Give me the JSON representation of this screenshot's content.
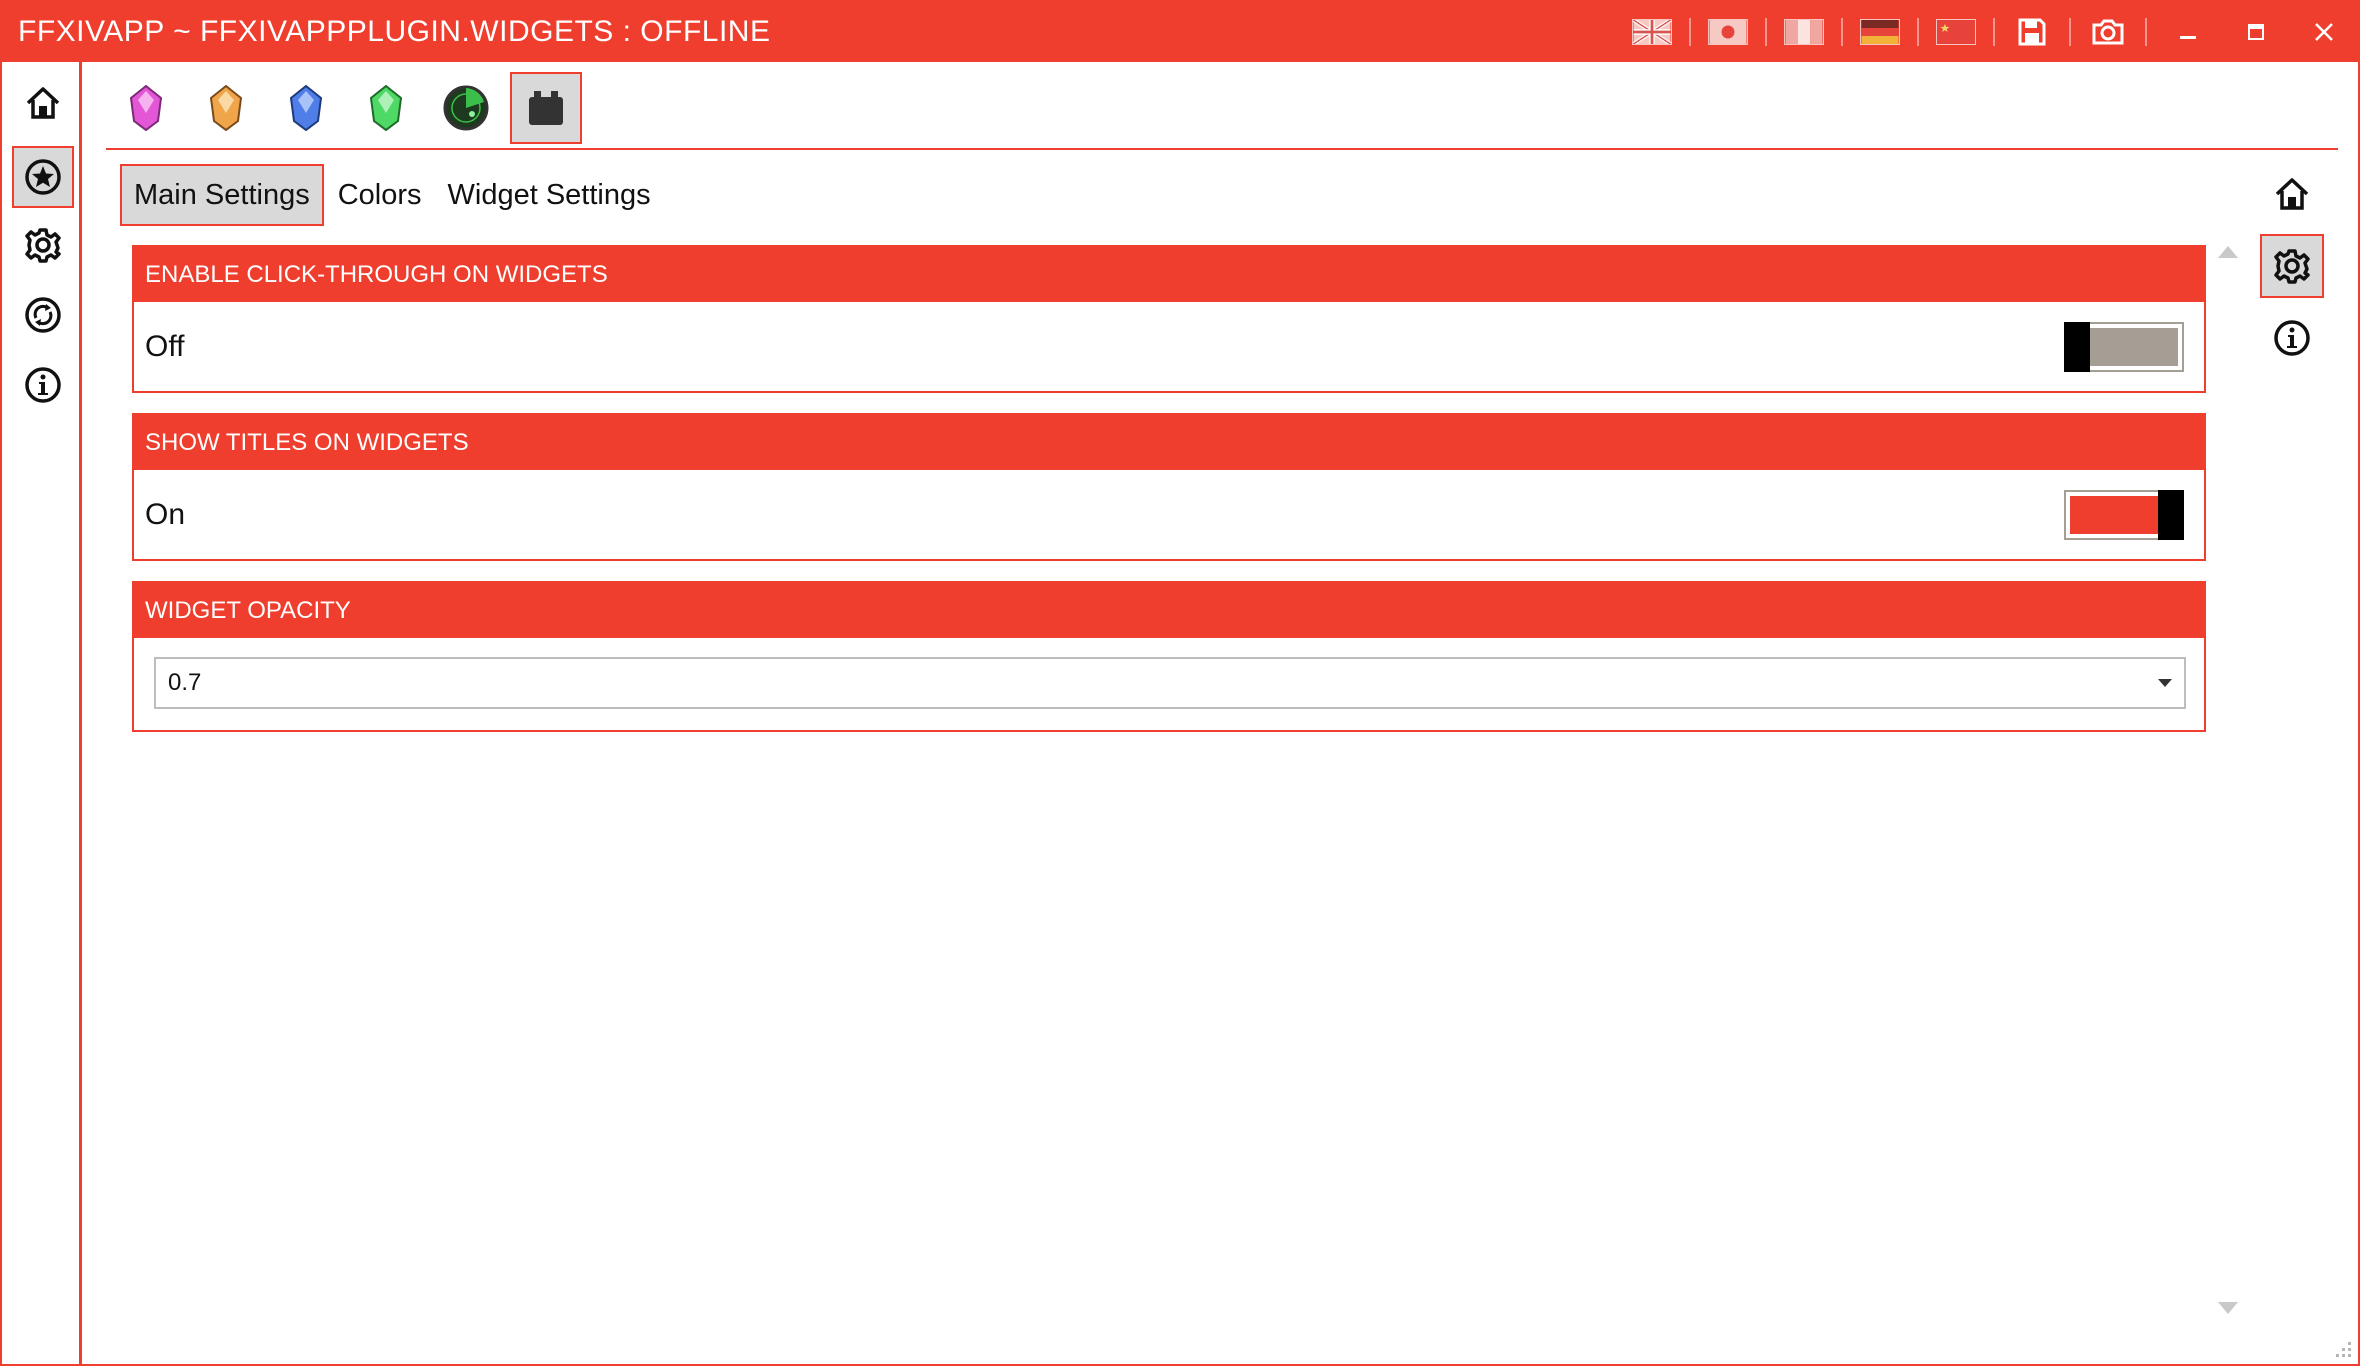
{
  "window": {
    "title": "FFXIVAPP ~ FFXIVAPPPLUGIN.WIDGETS : OFFLINE",
    "accent_color": "#ef3e2e",
    "toolbar_icons": [
      "flag-en-icon",
      "flag-jp-icon",
      "flag-fr-icon",
      "flag-de-icon",
      "flag-cn-icon",
      "save-icon",
      "camera-icon"
    ],
    "window_controls": [
      "minimize-icon",
      "maximize-icon",
      "close-icon"
    ]
  },
  "left_nav": {
    "items": [
      {
        "icon": "home-icon",
        "active": false
      },
      {
        "icon": "star-icon",
        "active": true
      },
      {
        "icon": "gear-icon",
        "active": false
      },
      {
        "icon": "update-icon",
        "active": false
      },
      {
        "icon": "info-icon",
        "active": false
      }
    ]
  },
  "plugins": {
    "items": [
      {
        "icon": "pink-crystal-icon",
        "color": "#e357d6",
        "active": false
      },
      {
        "icon": "orange-crystal-icon",
        "color": "#f0a54a",
        "active": false
      },
      {
        "icon": "blue-crystal-icon",
        "color": "#4f7ee8",
        "active": false
      },
      {
        "icon": "green-crystal-icon",
        "color": "#4ed865",
        "active": false
      },
      {
        "icon": "radar-icon",
        "color": "#2b9e36",
        "active": false
      },
      {
        "icon": "widget-icon",
        "color": "#333333",
        "active": true
      }
    ]
  },
  "tabs": [
    {
      "label": "Main Settings",
      "active": true
    },
    {
      "label": "Colors",
      "active": false
    },
    {
      "label": "Widget Settings",
      "active": false
    }
  ],
  "right_nav": {
    "items": [
      {
        "icon": "home-icon",
        "active": false
      },
      {
        "icon": "gear-icon",
        "active": true
      },
      {
        "icon": "info-icon",
        "active": false
      }
    ]
  },
  "settings": {
    "click_through": {
      "header": "ENABLE CLICK-THROUGH ON WIDGETS",
      "value_label": "Off",
      "enabled": false
    },
    "show_titles": {
      "header": "SHOW TITLES ON WIDGETS",
      "value_label": "On",
      "enabled": true
    },
    "opacity": {
      "header": "WIDGET OPACITY",
      "selected": "0.7"
    }
  }
}
